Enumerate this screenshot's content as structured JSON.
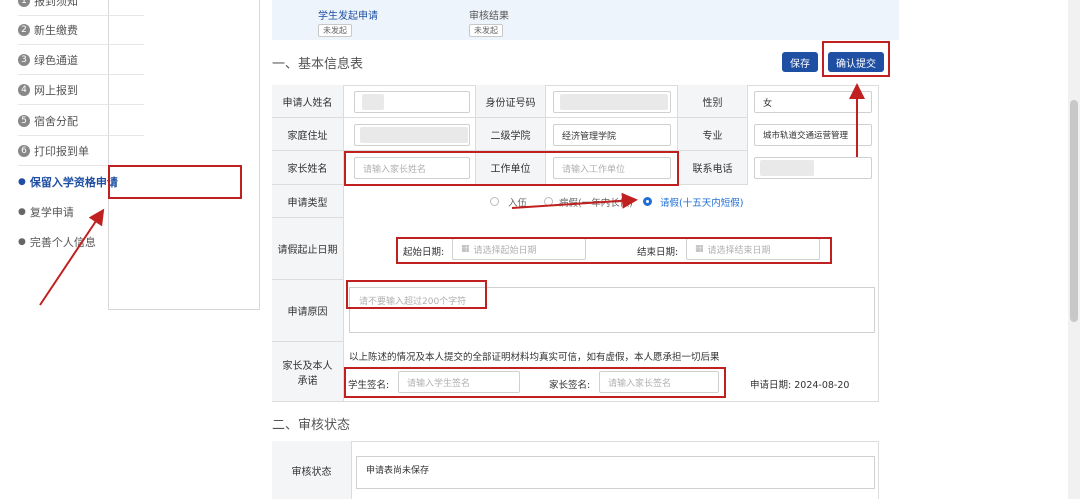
{
  "sidebar": {
    "items": [
      {
        "num": "1",
        "label": "报到须知"
      },
      {
        "num": "2",
        "label": "新生缴费"
      },
      {
        "num": "3",
        "label": "绿色通道"
      },
      {
        "num": "4",
        "label": "网上报到"
      },
      {
        "num": "5",
        "label": "宿舍分配"
      },
      {
        "num": "6",
        "label": "打印报到单"
      }
    ],
    "sub_items": [
      {
        "label": "保留入学资格申请",
        "active": true
      },
      {
        "label": "复学申请",
        "active": false
      },
      {
        "label": "完善个人信息",
        "active": false
      }
    ]
  },
  "status_bar": {
    "steps": [
      {
        "label": "学生发起申请",
        "tag": "未发起"
      },
      {
        "label": "审核结果",
        "tag": "未发起"
      }
    ]
  },
  "section1": {
    "title": "一、基本信息表"
  },
  "buttons": {
    "save": "保存",
    "submit": "确认提交"
  },
  "form": {
    "name_label": "申请人姓名",
    "id_label": "身份证号码",
    "gender_label": "性别",
    "gender_value": "女",
    "address_label": "家庭住址",
    "college_label": "二级学院",
    "college_value": "经济管理学院",
    "major_label": "专业",
    "major_value": "城市轨道交通运营管理",
    "parent_label": "家长姓名",
    "parent_placeholder": "请输入家长姓名",
    "work_label": "工作单位",
    "work_placeholder": "请输入工作单位",
    "phone_label": "联系电话",
    "type_label": "申请类型",
    "type_options": [
      {
        "label": "入伍",
        "selected": false
      },
      {
        "label": "病假(一年内长假)",
        "selected": false
      },
      {
        "label": "请假(十五天内短假)",
        "selected": true
      }
    ],
    "period_label": "请假起止日期",
    "start_label": "起始日期:",
    "start_placeholder": "请选择起始日期",
    "end_label": "结束日期:",
    "end_placeholder": "请选择结束日期",
    "reason_label": "申请原因",
    "reason_placeholder": "请不要输入超过200个字符",
    "pledge_label": "家长及本人承诺",
    "pledge_text": "以上陈述的情况及本人提交的全部证明材料均真实可信，如有虚假，本人愿承担一切后果",
    "student_sign_label": "学生签名:",
    "student_sign_placeholder": "请输入学生签名",
    "parent_sign_label": "家长签名:",
    "parent_sign_placeholder": "请输入家长签名",
    "date_label": "申请日期:",
    "date_value": "2024-08-20"
  },
  "section2": {
    "title": "二、审核状态",
    "status_label": "审核状态",
    "status_value": "申请表尚未保存"
  },
  "colors": {
    "accent": "#1f4fa3",
    "annotation": "#c0201f",
    "radio_selected": "#1f6fd6"
  }
}
